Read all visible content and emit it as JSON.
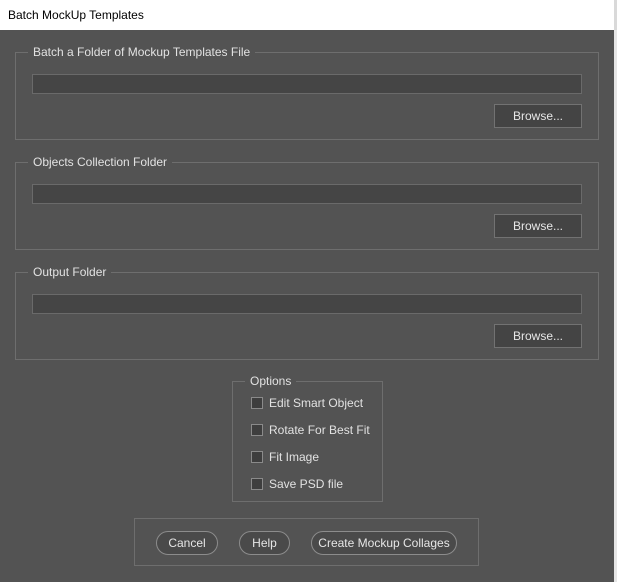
{
  "window": {
    "title": "Batch MockUp Templates"
  },
  "groups": {
    "templates": {
      "label": "Batch a Folder of Mockup Templates File",
      "path_value": "",
      "browse_label": "Browse..."
    },
    "objects": {
      "label": "Objects Collection Folder",
      "path_value": "",
      "browse_label": "Browse..."
    },
    "output": {
      "label": "Output Folder",
      "path_value": "",
      "browse_label": "Browse..."
    }
  },
  "options": {
    "label": "Options",
    "items": [
      {
        "label": "Edit Smart Object",
        "checked": false
      },
      {
        "label": "Rotate For Best Fit",
        "checked": false
      },
      {
        "label": "Fit Image",
        "checked": false
      },
      {
        "label": "Save PSD file",
        "checked": false
      }
    ]
  },
  "actions": {
    "cancel_label": "Cancel",
    "help_label": "Help",
    "create_label": "Create Mockup Collages"
  },
  "colors": {
    "panel_background": "#535353",
    "field_background": "#454545",
    "button_background": "#444444",
    "title_bar": "#ffffff"
  }
}
